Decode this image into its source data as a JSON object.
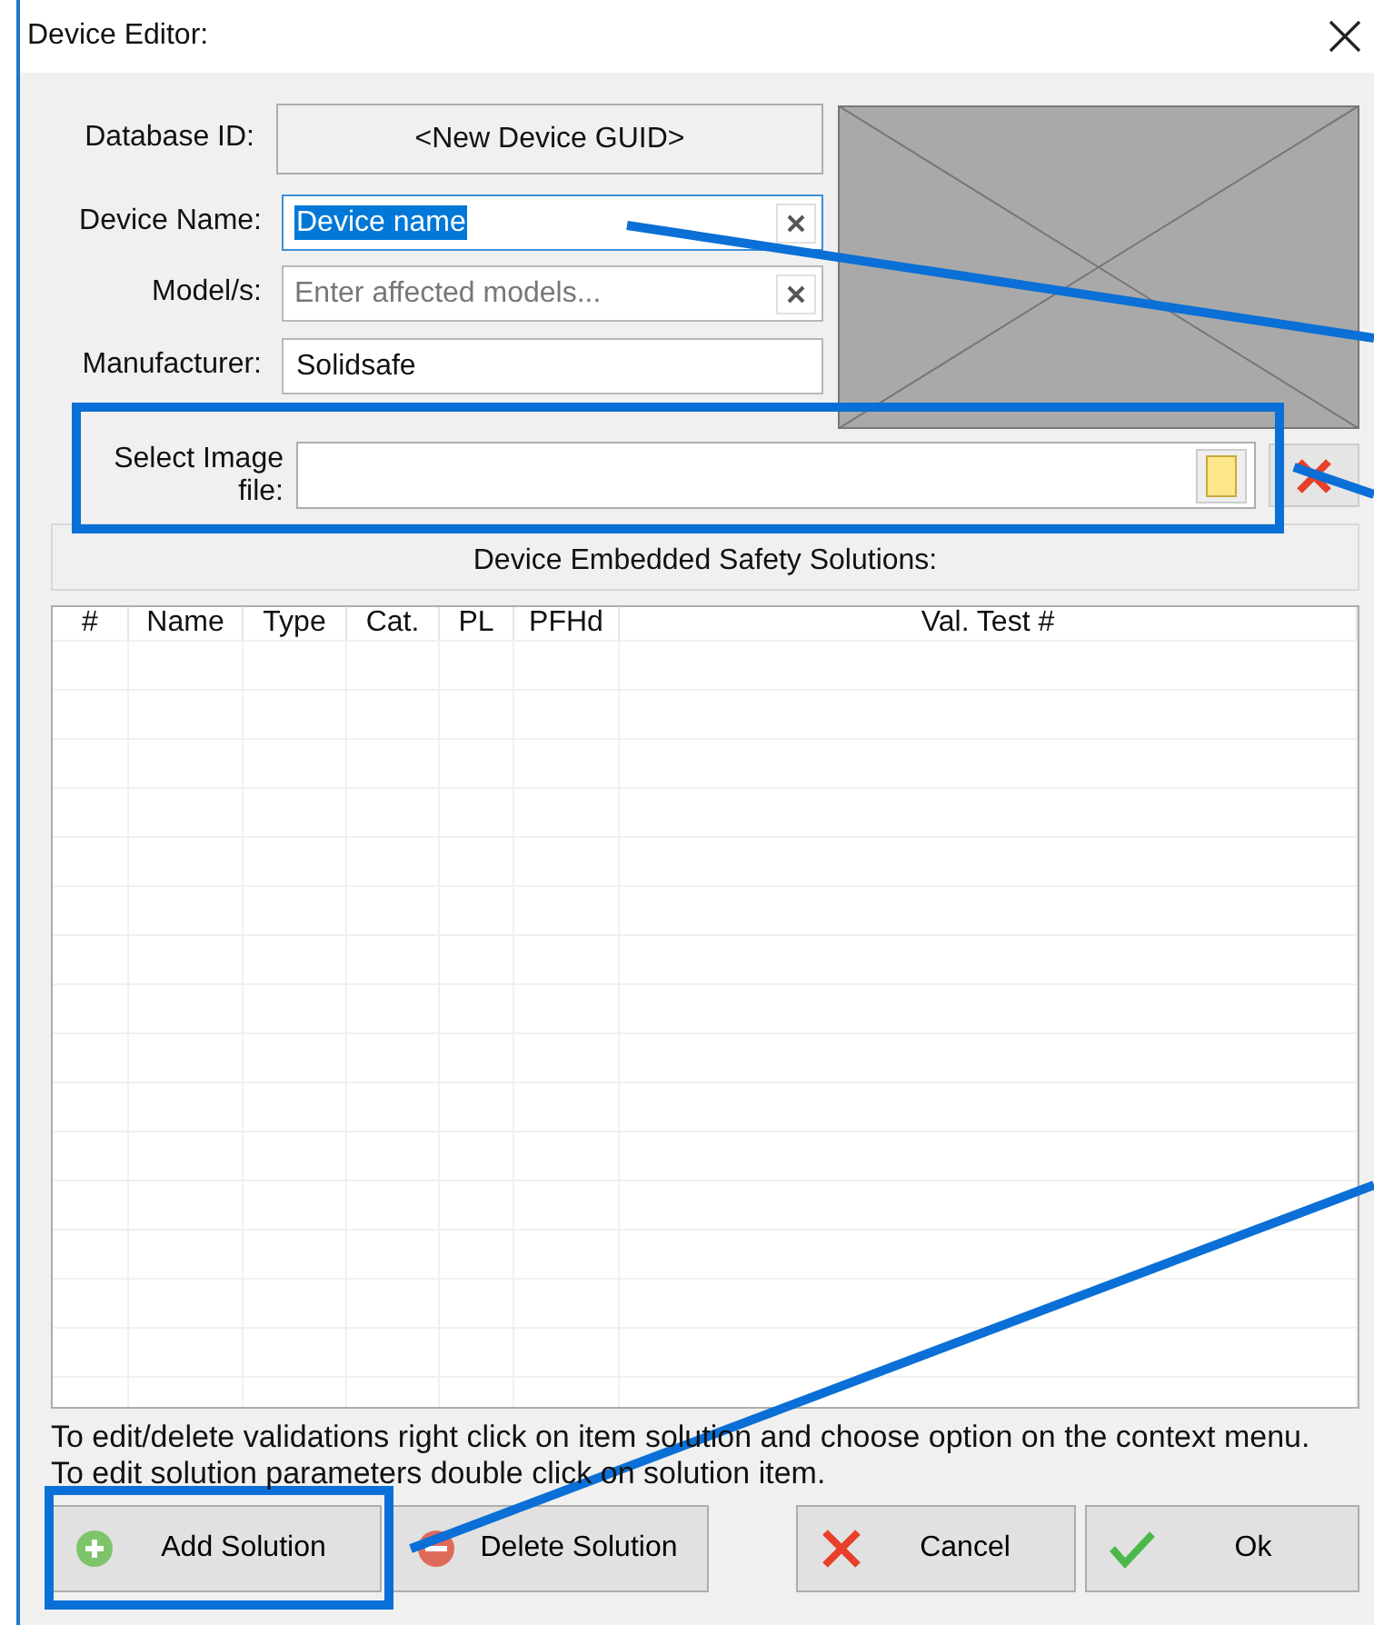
{
  "window": {
    "title": "Device Editor:"
  },
  "form": {
    "database_id": {
      "label": "Database ID:",
      "value": "<New Device GUID>"
    },
    "fields": [
      {
        "label": "Device Name:",
        "value": "Device name",
        "focused": true,
        "clearable": true
      },
      {
        "label": "Model/s:",
        "placeholder": "Enter affected models...",
        "focused": false,
        "clearable": true
      },
      {
        "label": "Manufacturer:",
        "value": "Solidsafe",
        "focused": false,
        "clearable": false
      }
    ],
    "image_file": {
      "label": "Select Image file:"
    }
  },
  "solutions": {
    "title": "Device Embedded Safety Solutions:",
    "columns": [
      "#",
      "Name",
      "Type",
      "Cat.",
      "PL",
      "PFHd",
      "Val. Test #"
    ]
  },
  "hints": [
    "To edit/delete validations right click on item solution and choose option on the context menu.",
    "To edit solution parameters double click on solution item."
  ],
  "buttons": [
    {
      "label": "Add Solution",
      "kind": "add"
    },
    {
      "label": "Delete Solution",
      "kind": "delete"
    },
    {
      "label": "Cancel",
      "kind": "cancel"
    },
    {
      "label": "Ok",
      "kind": "ok"
    }
  ]
}
